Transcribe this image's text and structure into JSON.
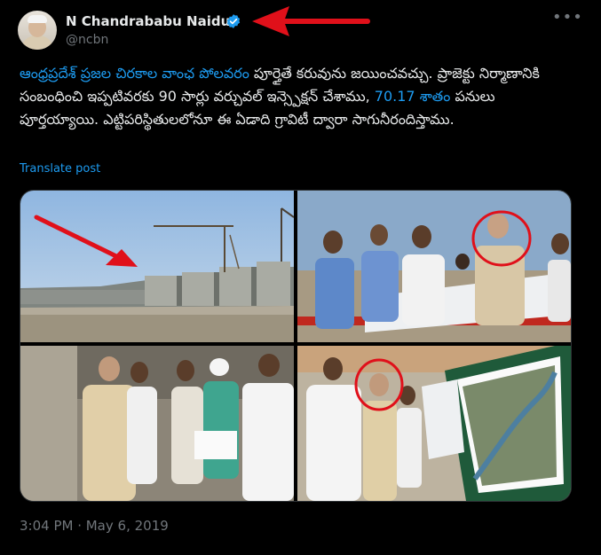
{
  "author": {
    "name": "N Chandrababu Naidu",
    "handle": "@ncbn",
    "verified": true
  },
  "icons": {
    "verified": "verified-badge-icon",
    "more": "more-options-icon"
  },
  "post": {
    "segments": [
      {
        "text": "ఆంధ్రప్రదేశ్ ప్రజల చిరకాల వాంఛ పోలవరం",
        "link": true
      },
      {
        "text": " పూర్తైతే కరువును జయించవచ్చు. ప్రాజెక్టు నిర్మాణానికి సంబంధించి ఇప్పటివరకు 90 సార్లు వర్చువల్ ఇన్స్పెక్షన్ చేశాము, ",
        "link": false
      },
      {
        "text": "70.17 శాతం",
        "link": true
      },
      {
        "text": " పనులు పూర్తయ్యాయి. ఎట్టిపరిస్థితులలోనూ ఈ ఏడాది గ్రావిటీ ద్వారా సాగునీరందిస్తాము.",
        "link": false
      }
    ],
    "translate_label": "Translate post",
    "timestamp": "3:04 PM · May 6, 2019"
  },
  "media": {
    "images": [
      {
        "name": "dam-construction-photo"
      },
      {
        "name": "site-inspection-photo"
      },
      {
        "name": "officials-walkway-photo"
      },
      {
        "name": "project-map-display-photo"
      }
    ]
  },
  "colors": {
    "background": "#000000",
    "text": "#e7e9ea",
    "muted": "#71767b",
    "accent": "#1d9bf0",
    "annotation": "#e0101a"
  }
}
